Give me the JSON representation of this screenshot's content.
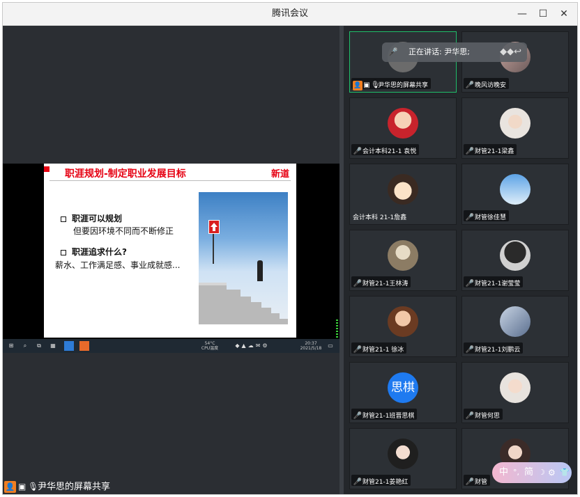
{
  "window": {
    "title": "腾讯会议",
    "minimize": "—",
    "maximize": "☐",
    "close": "✕"
  },
  "share": {
    "label": "尹华思的屏幕共享",
    "slide": {
      "title": "职涯规划-制定职业发展目标",
      "logo": "新道",
      "bullet1": "职涯可以规划",
      "sub1": "但要因环境不同而不断修正",
      "bullet2": "职涯追求什么?",
      "sub2": "薪水、工作满足感、事业成就感..."
    },
    "taskbar": {
      "cpu": "54°C\nCPU温度",
      "clock": "20:37\n2021/5/18"
    }
  },
  "speaking_toast": {
    "text": "正在讲话: 尹华思;"
  },
  "participants": [
    {
      "name": "尹华思的屏幕共享",
      "avatar": "",
      "host": true
    },
    {
      "name": "晚风访晚安",
      "avatar": ""
    },
    {
      "name": "会计本科21-1 袁悦",
      "avatar": ""
    },
    {
      "name": "财管21-1梁鑫",
      "avatar": ""
    },
    {
      "name": "会计本科 21-1詹鑫",
      "avatar": "",
      "unmuted": true
    },
    {
      "name": "财管徐佳慧",
      "avatar": ""
    },
    {
      "name": "财管21-1王林涛",
      "avatar": ""
    },
    {
      "name": "财管21-1谢莹莹",
      "avatar": ""
    },
    {
      "name": "财管21-1 徐冰",
      "avatar": ""
    },
    {
      "name": "财管21-1刘鹏云",
      "avatar": ""
    },
    {
      "name": "财管21-1班晋思棋",
      "avatar": "思棋"
    },
    {
      "name": "财管何思",
      "avatar": ""
    },
    {
      "name": "财管21-1姜艳红",
      "avatar": ""
    },
    {
      "name": "财管",
      "avatar": ""
    }
  ],
  "ime": {
    "lang": "中",
    "mode": "简"
  },
  "colors": {
    "accent": "#f07e21",
    "speaking_border": "#1fbf6a",
    "slide_red": "#e60012"
  }
}
